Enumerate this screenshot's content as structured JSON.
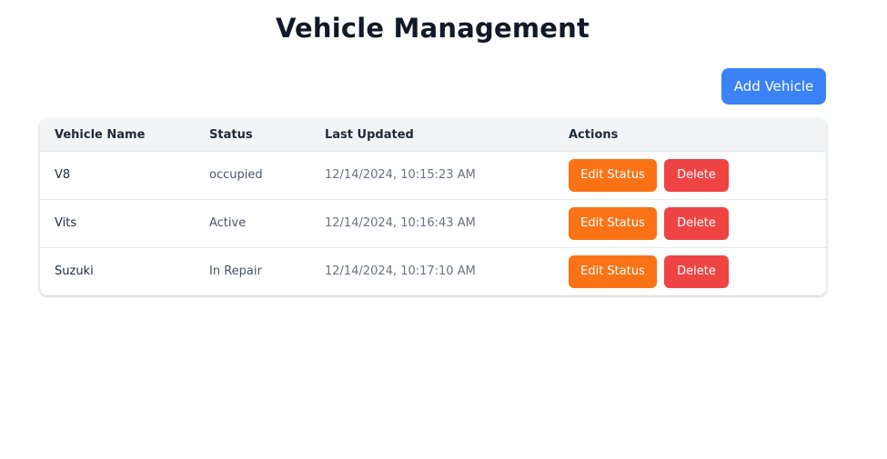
{
  "page": {
    "title": "Vehicle Management",
    "add_button_label": "Add Vehicle"
  },
  "colors": {
    "primary": "#3b82f6",
    "edit": "#f97316",
    "delete": "#ef4444",
    "header_bg": "#f3f4f6"
  },
  "table": {
    "columns": [
      "Vehicle Name",
      "Status",
      "Last Updated",
      "Actions"
    ],
    "rows": [
      {
        "name": "V8",
        "status": "occupied",
        "updated": "12/14/2024, 10:15:23 AM",
        "edit_label": "Edit Status",
        "delete_label": "Delete"
      },
      {
        "name": "Vits",
        "status": "Active",
        "updated": "12/14/2024, 10:16:43 AM",
        "edit_label": "Edit Status",
        "delete_label": "Delete"
      },
      {
        "name": "Suzuki",
        "status": "In Repair",
        "updated": "12/14/2024, 10:17:10 AM",
        "edit_label": "Edit Status",
        "delete_label": "Delete"
      }
    ]
  }
}
